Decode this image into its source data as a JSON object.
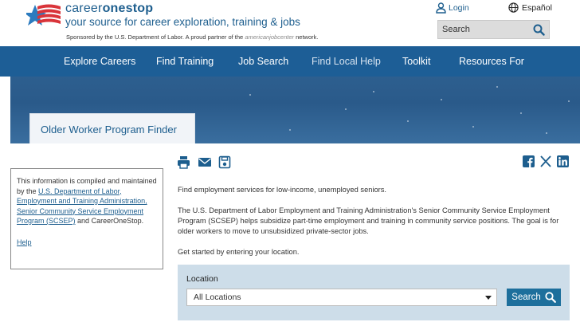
{
  "header": {
    "brand_part1": "career",
    "brand_part2": "onestop",
    "tagline": "your source for career exploration, training & jobs",
    "sponsor_prefix": "Sponsored by the U.S. Department of Labor. A proud partner of the",
    "sponsor_ajc": "americanjobcenter",
    "sponsor_suffix": "network.",
    "login_label": "Login",
    "espanol_label": "Español",
    "search_placeholder": "Search"
  },
  "nav": {
    "items": [
      {
        "label": "Explore Careers"
      },
      {
        "label": "Find Training"
      },
      {
        "label": "Job Search"
      },
      {
        "label": "Find Local Help"
      },
      {
        "label": "Toolkit"
      },
      {
        "label": "Resources For"
      }
    ]
  },
  "banner": {
    "tab_title": "Older Worker Program Finder"
  },
  "infobox": {
    "text_prefix": "This information is compiled and maintained by the",
    "link_text": "U.S. Department of Labor, Employment and Training Administration, Senior Community Service Employment Program (SCSEP)",
    "text_suffix": "and CareerOneStop.",
    "help_link": "Help"
  },
  "main": {
    "intro": "Find employment services for low-income, unemployed seniors.",
    "description": "The U.S. Department of Labor Employment and Training Administration's Senior Community Service Employment Program (SCSEP) helps subsidize part-time employment and training in community service positions. The goal is for older workers to move to unsubsidized private-sector jobs.",
    "get_started": "Get started by entering your location."
  },
  "location": {
    "label": "Location",
    "selected": "All Locations",
    "search_button": "Search"
  },
  "icons": {
    "print": "print-icon",
    "email": "email-icon",
    "save": "save-icon",
    "facebook": "facebook-icon",
    "x": "x-icon",
    "linkedin": "linkedin-icon"
  },
  "colors": {
    "nav_bg": "#1d5e96",
    "brand_blue": "#1d5e8e",
    "location_box_bg": "#cddde9",
    "search_button_bg": "#1d6f9c"
  }
}
